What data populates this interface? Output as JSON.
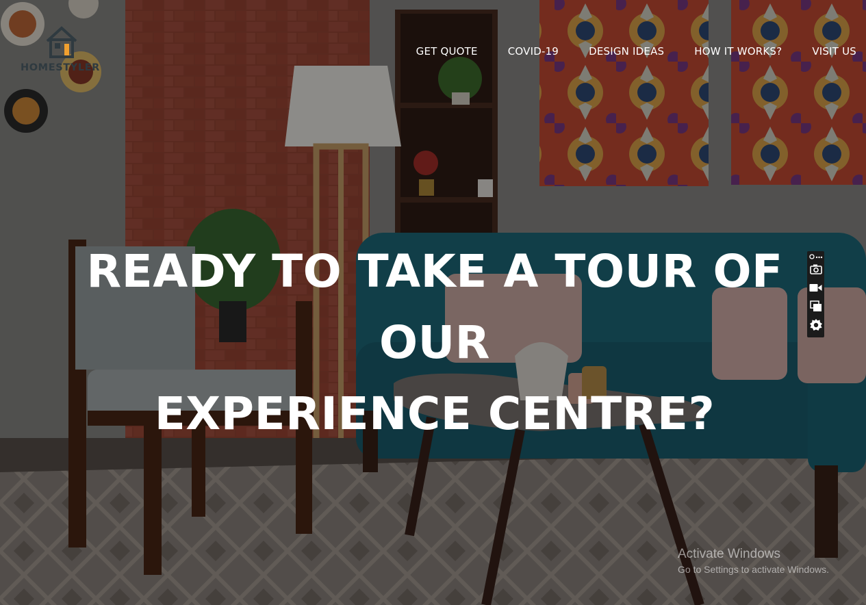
{
  "brand": {
    "name": "HOMESTYLER"
  },
  "nav": {
    "items": [
      {
        "label": "GET QUOTE"
      },
      {
        "label": "COVID-19"
      },
      {
        "label": "DESIGN IDEAS"
      },
      {
        "label": "HOW IT WORKS?"
      },
      {
        "label": "VISIT US"
      }
    ]
  },
  "hero": {
    "headline_line1": "READY TO TAKE A TOUR OF OUR",
    "headline_line2": "EXPERIENCE CENTRE?"
  },
  "toolbar": {
    "icons": [
      "more-icon",
      "camera-icon",
      "video-icon",
      "window-icon",
      "gear-icon"
    ]
  },
  "watermark": {
    "title": "Activate Windows",
    "subtitle": "Go to Settings to activate Windows."
  },
  "colors": {
    "logo_dark": "#2f3a40",
    "logo_accent": "#f0a030",
    "brick": "#a24a38",
    "sofa": "#1e6c7c",
    "wall": "#6b6b68"
  }
}
